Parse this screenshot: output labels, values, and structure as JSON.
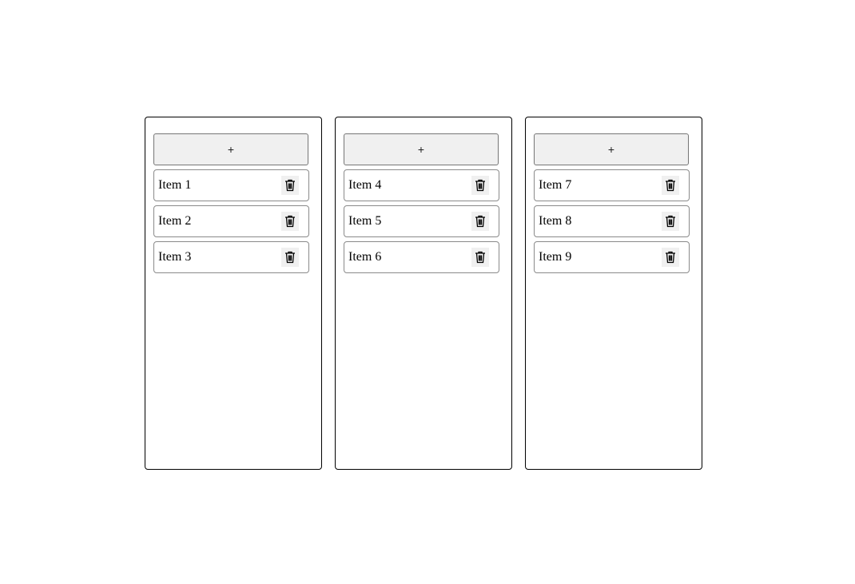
{
  "columns": [
    {
      "add_label": "+",
      "items": [
        {
          "label": "Item 1"
        },
        {
          "label": "Item 2"
        },
        {
          "label": "Item 3"
        }
      ]
    },
    {
      "add_label": "+",
      "items": [
        {
          "label": "Item 4"
        },
        {
          "label": "Item 5"
        },
        {
          "label": "Item 6"
        }
      ]
    },
    {
      "add_label": "+",
      "items": [
        {
          "label": "Item 7"
        },
        {
          "label": "Item 8"
        },
        {
          "label": "Item 9"
        }
      ]
    }
  ],
  "icons": {
    "delete": "trash-icon"
  },
  "colors": {
    "button_bg": "#f0f0f0",
    "border": "#000000"
  }
}
